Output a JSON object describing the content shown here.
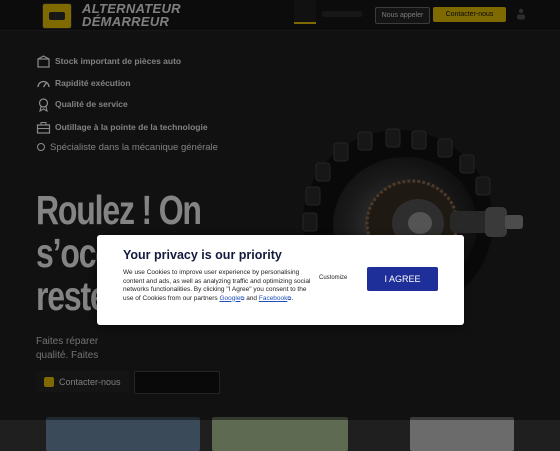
{
  "header": {
    "logo_line1": "ALTERNATEUR",
    "logo_line2": "DÉMARREUR",
    "call_label": "Nous appeler",
    "contact_label": "Contacter-nous"
  },
  "hero": {
    "features": [
      {
        "icon": "box-stock-icon",
        "text": "Stock important de pièces auto"
      },
      {
        "icon": "speedometer-icon",
        "text": "Rapidité exécution"
      },
      {
        "icon": "medal-quality-icon",
        "text": "Qualité de service"
      },
      {
        "icon": "toolbox-icon",
        "text": "Outillage à la pointe de la technologie"
      },
      {
        "icon": "circle-bullet-icon",
        "text": "Spécialiste dans la mécanique générale"
      }
    ],
    "headline_line1": "Roulez ! On",
    "headline_line2": "s’occupe du",
    "headline_line3": "reste",
    "subtext_line1": "Faites réparer",
    "subtext_line2": "qualité. Faites",
    "contact_button": "Contacter-nous"
  },
  "privacy_modal": {
    "title": "Your privacy is our priority",
    "body": "We use Cookies to improve user experience by personalising content and ads, as well as analyzing traffic and optimizing social networks functionalities. By clicking \"I Agree\" you consent to the use of Cookies from our partners",
    "link_google": "Google",
    "link_and": "and",
    "link_facebook": "Facebook",
    "customize_label": "Customize",
    "agree_label": "I AGREE"
  },
  "colors": {
    "accent": "#e6c200",
    "background": "#1f1f1f",
    "agree_button": "#1e2f9a",
    "modal_title": "#141a3d"
  }
}
